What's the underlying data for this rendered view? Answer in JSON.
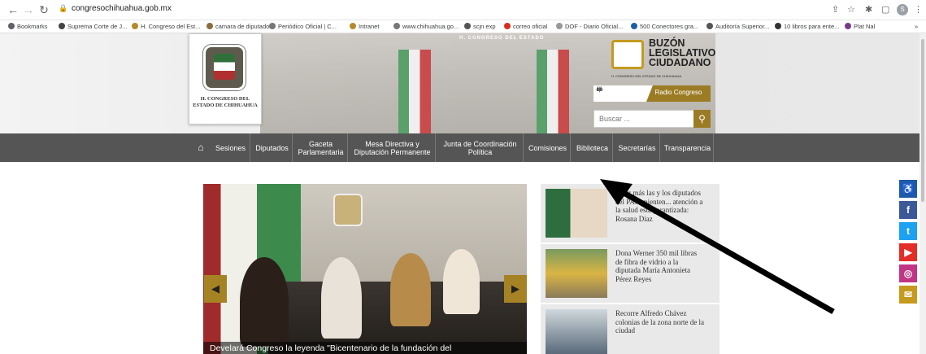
{
  "browser": {
    "url": "congresochihuahua.gob.mx",
    "avatar_initial": "S",
    "bookmarks": [
      {
        "label": "Bookmarks",
        "color": "#5f6368"
      },
      {
        "label": "Suprema Corte de J...",
        "color": "#444"
      },
      {
        "label": "H. Congreso del Est...",
        "color": "#b58a2a"
      },
      {
        "label": "camara de diputados",
        "color": "#8a6d3b"
      },
      {
        "label": "Periódico Oficial | C...",
        "color": "#777"
      },
      {
        "label": "Intranet",
        "color": "#b58a2a"
      },
      {
        "label": "www.chihuahua.go...",
        "color": "#777"
      },
      {
        "label": "scjn exp",
        "color": "#555"
      },
      {
        "label": "correo oficial",
        "color": "#d92d20"
      },
      {
        "label": "DOF - Diario Oficial...",
        "color": "#999"
      },
      {
        "label": "500 Conectores gra...",
        "color": "#1d5fa5"
      },
      {
        "label": "Auditoría Superior...",
        "color": "#555"
      },
      {
        "label": "10 libros para ente...",
        "color": "#333"
      },
      {
        "label": "Plat Nal",
        "color": "#7a3a8a"
      }
    ],
    "more": "»"
  },
  "header": {
    "chamber_sign": "H. CONGRESO DEL ESTADO",
    "logo_text": "H. CONGRESO DEL ESTADO DE CHIHUAHUA",
    "buzon_title": "BUZÓN LEGISLATIVO CIUDADANO",
    "buzon_sub": "H. CONGRESO DEL ESTADO DE CHIHUAHUA",
    "radio_waves": "·ıllı|ıllı·",
    "radio_label": "Radio Congreso",
    "search_placeholder": "Buscar ...",
    "accent": "#9b7c24"
  },
  "nav": {
    "items": [
      "Sesiones",
      "Diputados",
      "Gaceta Parlamentaria",
      "Mesa Directiva y Diputación Permanente",
      "Junta de Coordinación Política",
      "Comisiones",
      "Biblioteca",
      "Secretarías",
      "Transparencia"
    ]
  },
  "slider": {
    "caption": "Develará Congreso la leyenda \"Bicentenario de la fundación del"
  },
  "news": [
    {
      "title": "...vez más las y los diputados del PAN mienten... atención a la salud esta garantizada: Rosana Díaz"
    },
    {
      "title": "Dona Werner 350 mil libras de fibra de vidrio a la diputada María Antonieta Pérez Reyes"
    },
    {
      "title": "Recorre Alfredo Chávez colonias de la zona norte de la ciudad"
    }
  ],
  "social": [
    {
      "name": "accessibility-icon",
      "glyph": "♿",
      "color": "#1e5aa8"
    },
    {
      "name": "facebook-icon",
      "glyph": "f",
      "color": "#3b5998"
    },
    {
      "name": "twitter-icon",
      "glyph": "t",
      "color": "#1da1f2"
    },
    {
      "name": "youtube-icon",
      "glyph": "▶",
      "color": "#e52d27"
    },
    {
      "name": "instagram-icon",
      "glyph": "◎",
      "color": "#c13584"
    },
    {
      "name": "mail-icon",
      "glyph": "✉",
      "color": "#c69a1f"
    }
  ]
}
